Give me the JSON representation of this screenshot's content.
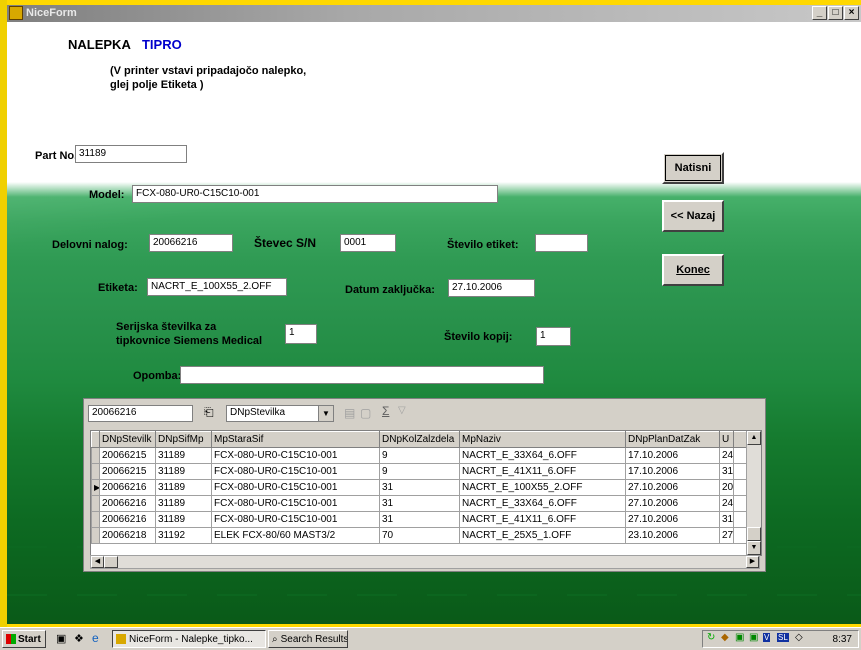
{
  "window": {
    "title": "NiceForm",
    "min_label": "_",
    "max_label": "□",
    "close_label": "×"
  },
  "form": {
    "heading": "NALEPKA",
    "heading_accent": "TIPRO",
    "note_line1": "(V printer vstavi pripadajočo nalepko,",
    "note_line2": "glej polje Etiketa )",
    "part_no_label": "Part No.:",
    "part_no_value": "31189",
    "model_label": "Model:",
    "model_value": "FCX-080-UR0-C15C10-001",
    "delovni_label": "Delovni nalog:",
    "delovni_value": "20066216",
    "stevec_label": "Števec S/N",
    "stevec_value": "0001",
    "st_etiket_label": "Število etiket:",
    "st_etiket_value": "",
    "etiketa_label": "Etiketa:",
    "etiketa_value": "NACRT_E_100X55_2.OFF",
    "datum_label": "Datum zaključka:",
    "datum_value": "27.10.2006",
    "serijska_line1": "Serijska številka za",
    "serijska_line2": "tipkovnice Siemens Medical",
    "serijska_value": "1",
    "st_kopij_label": "Število kopij:",
    "st_kopij_value": "1",
    "opomba_label": "Opomba:",
    "opomba_value": ""
  },
  "buttons": {
    "natisni": "Natisni",
    "nazaj": "<< Nazaj",
    "konec": "Konec"
  },
  "grid": {
    "search_value": "20066216",
    "search_field": "DNpStevilka",
    "columns": [
      "DNpStevilk",
      "DNpSifMp",
      "MpStaraSif",
      "DNpKolZalzdela",
      "MpNaziv",
      "DNpPlanDatZak",
      "U"
    ],
    "rows": [
      [
        "20066215",
        "31189",
        "FCX-080-UR0-C15C10-001",
        "9",
        "NACRT_E_33X64_6.OFF",
        "17.10.2006",
        "24"
      ],
      [
        "20066215",
        "31189",
        "FCX-080-UR0-C15C10-001",
        "9",
        "NACRT_E_41X11_6.OFF",
        "17.10.2006",
        "31"
      ],
      [
        "20066216",
        "31189",
        "FCX-080-UR0-C15C10-001",
        "31",
        "NACRT_E_100X55_2.OFF",
        "27.10.2006",
        "20"
      ],
      [
        "20066216",
        "31189",
        "FCX-080-UR0-C15C10-001",
        "31",
        "NACRT_E_33X64_6.OFF",
        "27.10.2006",
        "24"
      ],
      [
        "20066216",
        "31189",
        "FCX-080-UR0-C15C10-001",
        "31",
        "NACRT_E_41X11_6.OFF",
        "27.10.2006",
        "31"
      ],
      [
        "20066218",
        "31192",
        "ELEK FCX-80/60 MAST3/2",
        "70",
        "NACRT_E_25X5_1.OFF",
        "23.10.2006",
        "27"
      ]
    ],
    "current_row": 2
  },
  "taskbar": {
    "start": "Start",
    "task1": "NiceForm - Nalepke_tipko...",
    "task2": "Search Results",
    "tray_lang": "SL",
    "clock": "8:37"
  }
}
